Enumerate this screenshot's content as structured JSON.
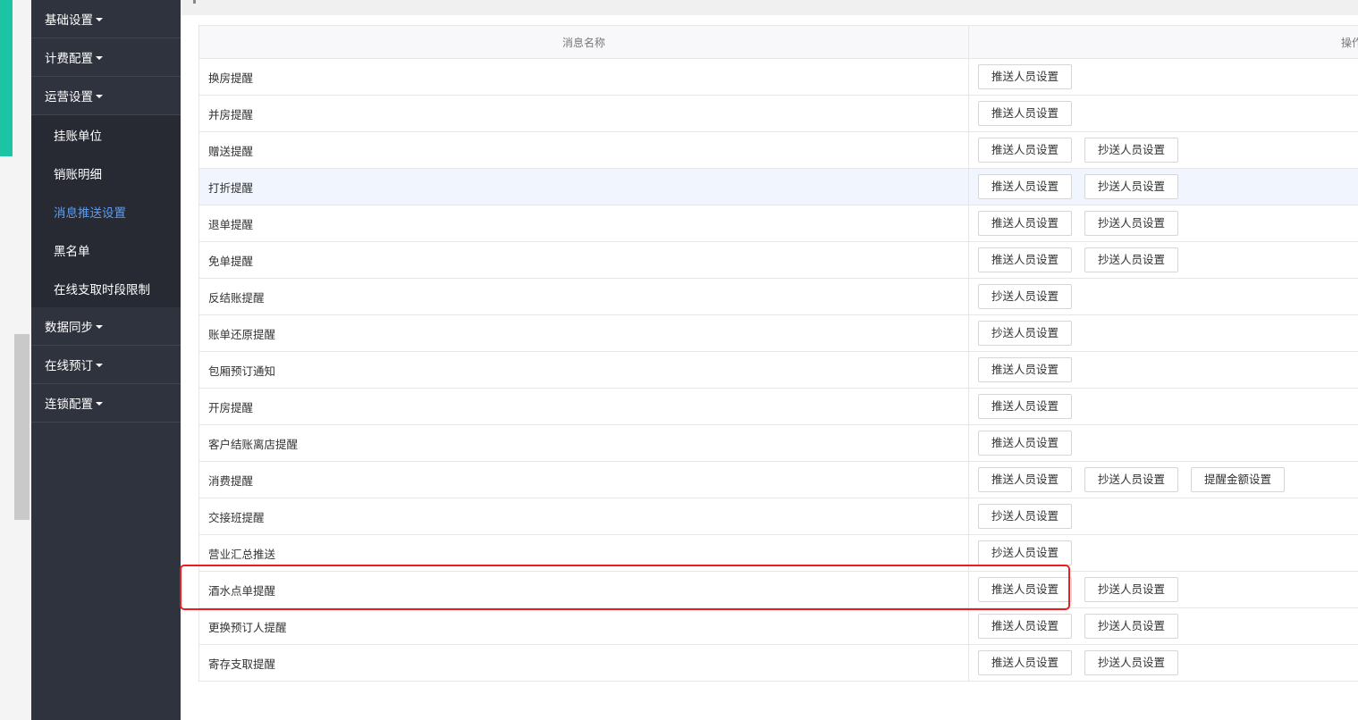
{
  "sidebar": {
    "groups_top": [
      {
        "label": "基础设置"
      },
      {
        "label": "计费配置"
      },
      {
        "label": "运营设置"
      }
    ],
    "submenu": [
      {
        "label": "挂账单位",
        "active": false
      },
      {
        "label": "销账明细",
        "active": false
      },
      {
        "label": "消息推送设置",
        "active": true
      },
      {
        "label": "黑名单",
        "active": false
      },
      {
        "label": "在线支取时段限制",
        "active": false
      }
    ],
    "groups_bottom": [
      {
        "label": "数据同步"
      },
      {
        "label": "在线预订"
      },
      {
        "label": "连锁配置"
      }
    ]
  },
  "table": {
    "headers": {
      "name": "消息名称",
      "operation": "操作"
    },
    "rows": [
      {
        "name": "换房提醒",
        "buttons": [
          "推送人员设置"
        ]
      },
      {
        "name": "并房提醒",
        "buttons": [
          "推送人员设置"
        ]
      },
      {
        "name": "赠送提醒",
        "buttons": [
          "推送人员设置",
          "抄送人员设置"
        ]
      },
      {
        "name": "打折提醒",
        "buttons": [
          "推送人员设置",
          "抄送人员设置"
        ],
        "highlighted": true
      },
      {
        "name": "退单提醒",
        "buttons": [
          "推送人员设置",
          "抄送人员设置"
        ]
      },
      {
        "name": "免单提醒",
        "buttons": [
          "推送人员设置",
          "抄送人员设置"
        ]
      },
      {
        "name": "反结账提醒",
        "buttons": [
          "抄送人员设置"
        ]
      },
      {
        "name": "账单还原提醒",
        "buttons": [
          "抄送人员设置"
        ]
      },
      {
        "name": "包厢预订通知",
        "buttons": [
          "推送人员设置"
        ]
      },
      {
        "name": "开房提醒",
        "buttons": [
          "推送人员设置"
        ]
      },
      {
        "name": "客户结账离店提醒",
        "buttons": [
          "推送人员设置"
        ]
      },
      {
        "name": "消费提醒",
        "buttons": [
          "推送人员设置",
          "抄送人员设置",
          "提醒金额设置"
        ]
      },
      {
        "name": "交接班提醒",
        "buttons": [
          "抄送人员设置"
        ]
      },
      {
        "name": "营业汇总推送",
        "buttons": [
          "抄送人员设置"
        ]
      },
      {
        "name": "酒水点单提醒",
        "buttons": [
          "推送人员设置",
          "抄送人员设置"
        ]
      },
      {
        "name": "更换预订人提醒",
        "buttons": [
          "推送人员设置",
          "抄送人员设置"
        ]
      },
      {
        "name": "寄存支取提醒",
        "buttons": [
          "推送人员设置",
          "抄送人员设置"
        ]
      }
    ]
  },
  "annotation": {
    "color": "#ee1c1c"
  }
}
